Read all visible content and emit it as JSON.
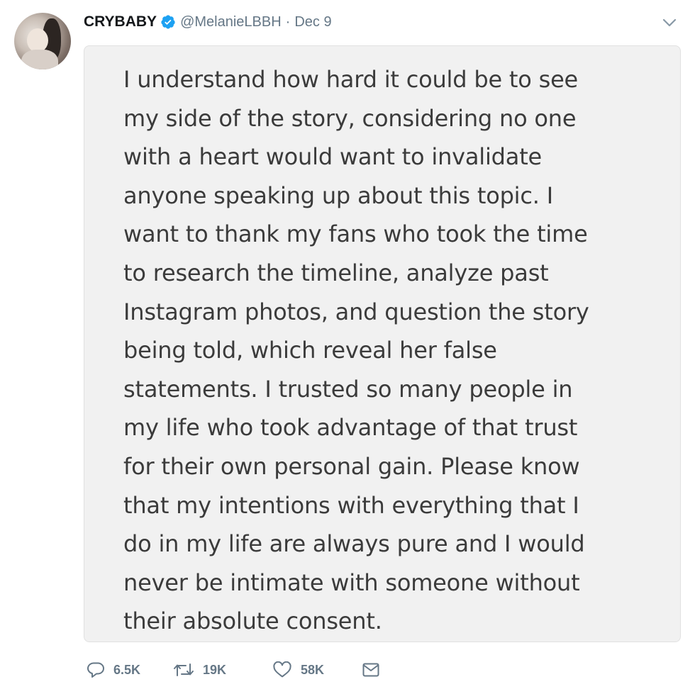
{
  "tweet": {
    "display_name": "CRYBABY",
    "handle": "@MelanieLBBH",
    "separator": "·",
    "date": "Dec 9",
    "verified_icon": "verified-badge-icon",
    "menu_icon": "chevron-down-icon"
  },
  "image_text": {
    "lines": [
      "I understand how hard it could be to see",
      "my side of the story, considering no one",
      "with a heart would want to invalidate",
      "anyone speaking up about this topic.  I",
      "want to thank my fans who took the time",
      "to research the timeline, analyze past",
      "Instagram photos, and question the story",
      "being told, which reveal her false",
      "statements. I trusted so many people in",
      "my life who took advantage of that trust",
      "for their own personal gain. Please know",
      "that my intentions with everything that I",
      "do in my life are always pure and I would",
      "never be intimate with someone without",
      "their absolute consent."
    ]
  },
  "actions": {
    "reply": {
      "icon": "reply-icon",
      "count": "6.5K"
    },
    "retweet": {
      "icon": "retweet-icon",
      "count": "19K"
    },
    "like": {
      "icon": "heart-icon",
      "count": "58K"
    },
    "message": {
      "icon": "envelope-icon"
    }
  },
  "colors": {
    "verified_blue": "#1da1f2",
    "secondary_text": "#657786",
    "primary_text": "#14171a",
    "card_background": "#f1f1f1"
  }
}
